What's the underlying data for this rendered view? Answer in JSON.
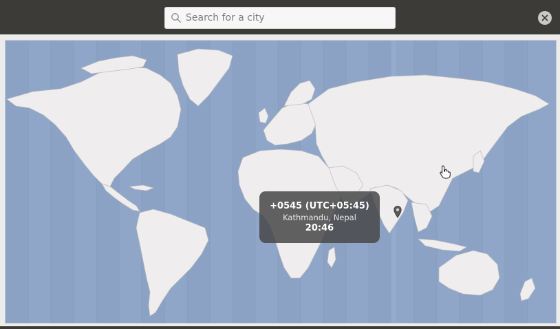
{
  "search": {
    "placeholder": "Search for a city",
    "value": ""
  },
  "close_icon": "close-icon",
  "tooltip": {
    "offset": "+0545 (UTC+05:45)",
    "city": "Kathmandu, Nepal",
    "time": "20:46"
  },
  "colors": {
    "ocean": "#8fa6c9",
    "land": "#efeded",
    "timezone_band": "#8ea3c4",
    "header": "#3c3b37",
    "tooltip_bg": "#484848"
  },
  "icons": [
    "search-icon",
    "close-icon",
    "location-pin-icon",
    "hand-pointer-icon"
  ]
}
